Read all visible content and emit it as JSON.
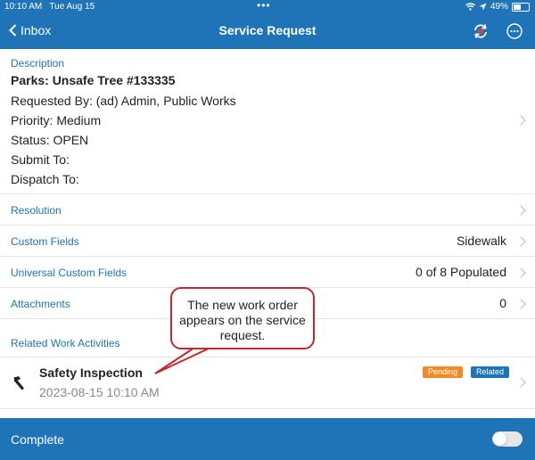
{
  "statusbar": {
    "time": "10:10 AM",
    "date": "Tue Aug 15",
    "dots": "•••",
    "battery": "49%",
    "battery_level": 0.49
  },
  "nav": {
    "back_label": "Inbox",
    "title": "Service Request"
  },
  "description": {
    "header": "Description",
    "title": "Parks: Unsafe Tree #133335",
    "requested_by": "Requested By: (ad) Admin, Public Works",
    "priority": "Priority: Medium",
    "status": "Status: OPEN",
    "submit_to": "Submit To:",
    "dispatch_to": "Dispatch To:"
  },
  "rows": {
    "resolution": {
      "label": "Resolution",
      "value": ""
    },
    "custom_fields": {
      "label": "Custom Fields",
      "value": "Sidewalk"
    },
    "universal_custom_fields": {
      "label": "Universal Custom Fields",
      "value": "0 of 8 Populated"
    },
    "attachments": {
      "label": "Attachments",
      "value": "0"
    }
  },
  "related": {
    "header": "Related Work Activities",
    "item": {
      "title": "Safety Inspection",
      "date": "2023-08-15 10:10 AM",
      "badge_pending": "Pending",
      "badge_related": "Related"
    }
  },
  "footer": {
    "label": "Complete",
    "toggle_on": false
  },
  "callout": {
    "text": "The new work order appears on the service request."
  },
  "colors": {
    "accent": "#1f73b7",
    "pending": "#f08a24",
    "related": "#1f73b7",
    "callout_border": "#c0282d"
  }
}
